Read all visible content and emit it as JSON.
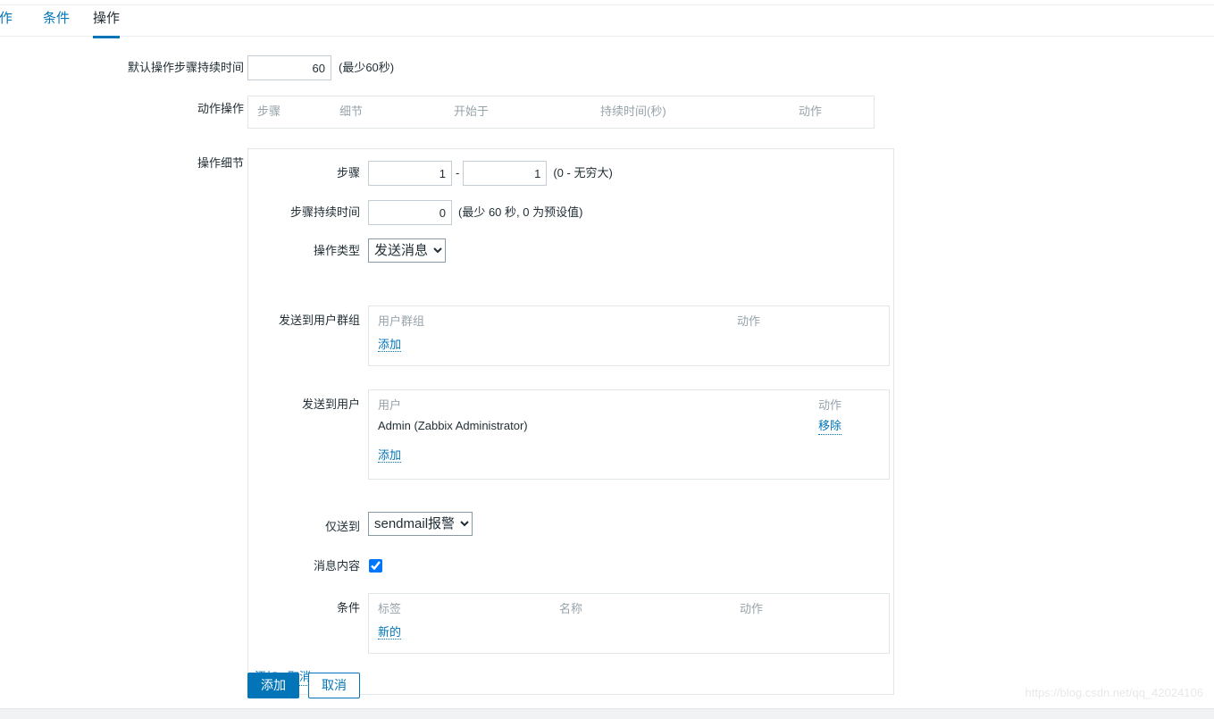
{
  "tabs": [
    {
      "label": "动作",
      "active": false
    },
    {
      "label": "条件",
      "active": false
    },
    {
      "label": "操作",
      "active": true
    }
  ],
  "form": {
    "default_step_duration": {
      "label": "默认操作步骤持续时间",
      "value": "60",
      "hint": "(最少60秒)"
    },
    "action_operations": {
      "label": "动作操作",
      "headers": [
        "步骤",
        "细节",
        "开始于",
        "持续时间(秒)",
        "动作"
      ]
    },
    "operation_details": {
      "label": "操作细节",
      "steps": {
        "label": "步骤",
        "from": "1",
        "to": "1",
        "separator": "-",
        "hint": "(0 - 无穷大)"
      },
      "step_duration": {
        "label": "步骤持续时间",
        "value": "0",
        "hint": "(最少 60 秒, 0 为预设值)"
      },
      "operation_type": {
        "label": "操作类型",
        "selected": "发送消息",
        "options": [
          "发送消息"
        ]
      },
      "send_to_user_groups": {
        "label": "发送到用户群组",
        "headers": [
          "用户群组",
          "动作"
        ],
        "rows": [],
        "add_label": "添加"
      },
      "send_to_users": {
        "label": "发送到用户",
        "headers": [
          "用户",
          "动作"
        ],
        "rows": [
          {
            "name": "Admin (Zabbix Administrator)",
            "action": "移除"
          }
        ],
        "add_label": "添加"
      },
      "send_only_to": {
        "label": "仅送到",
        "selected": "sendmail报警",
        "options": [
          "sendmail报警"
        ]
      },
      "message_content": {
        "label": "消息内容",
        "checked": true
      },
      "conditions": {
        "label": "条件",
        "headers": [
          "标签",
          "名称",
          "动作"
        ],
        "rows": [],
        "new_label": "新的"
      },
      "inline_actions": {
        "add_label": "添加",
        "cancel_label": "取消"
      }
    }
  },
  "footer": {
    "submit_label": "添加",
    "cancel_label": "取消"
  },
  "watermark": "https://blog.csdn.net/qq_42024106",
  "colors": {
    "accent": "#0275b8",
    "text": "#1f2c33",
    "muted": "#97a3ab",
    "border": "#e1e6e9"
  }
}
